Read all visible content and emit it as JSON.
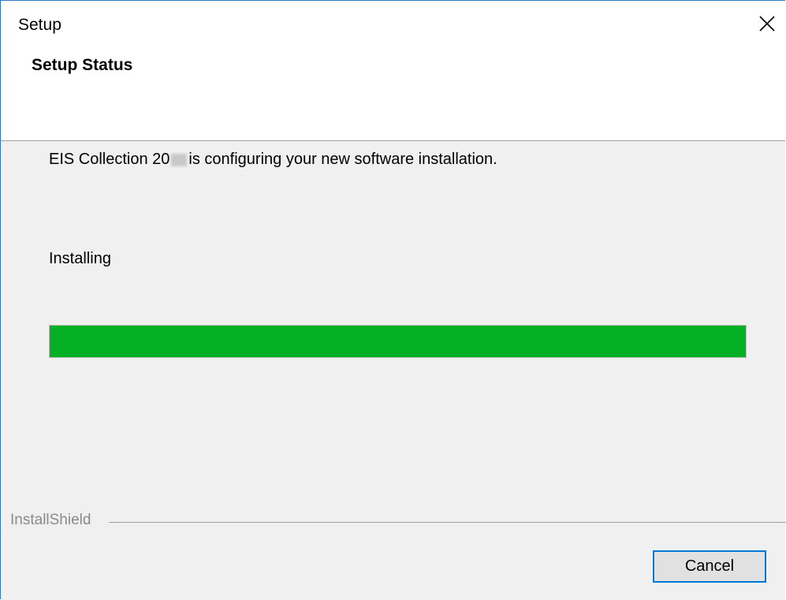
{
  "window": {
    "title": "Setup"
  },
  "header": {
    "title": "Setup Status"
  },
  "main": {
    "message_prefix": "EIS Collection 20",
    "message_suffix": "is configuring your new software installation.",
    "status": "Installing",
    "progress_fraction": 1.0
  },
  "footer": {
    "brand": "InstallShield",
    "cancel_label": "Cancel"
  },
  "colors": {
    "progress_fill": "#06b025",
    "focus_border": "#0078d7",
    "content_bg": "#f0f0f0"
  },
  "icons": {
    "close": "close-icon"
  }
}
